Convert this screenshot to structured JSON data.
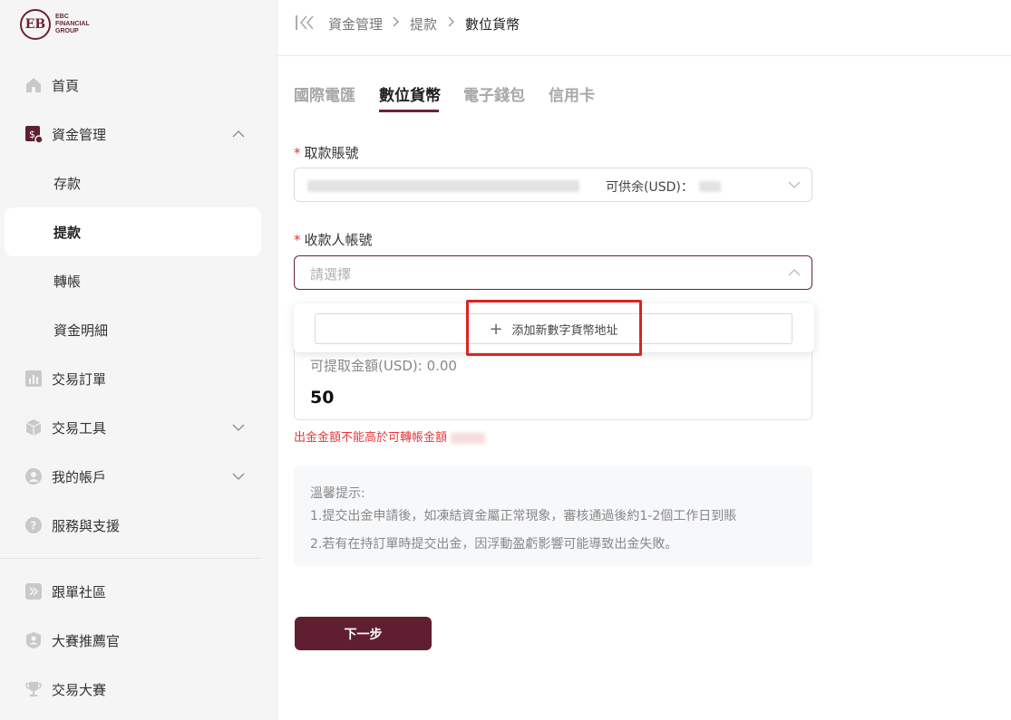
{
  "brand": {
    "logo_text": "EBC\nFINANCIAL\nGROUP",
    "accent": "#6b2434",
    "button_color": "#5f1f30"
  },
  "sidebar": {
    "home": "首頁",
    "funds": "資金管理",
    "deposit": "存款",
    "withdraw": "提款",
    "transfer": "轉帳",
    "funds_detail": "資金明細",
    "orders": "交易訂單",
    "tools": "交易工具",
    "account": "我的帳戶",
    "support": "服務與支援",
    "copy": "跟單社區",
    "referral": "大賽推薦官",
    "contest": "交易大賽"
  },
  "breadcrumb": {
    "level1": "資金管理",
    "level2": "提款",
    "current": "數位貨幣"
  },
  "tabs": [
    "國際電匯",
    "數位貨幣",
    "電子錢包",
    "信用卡"
  ],
  "form": {
    "account_label": "取款賬號",
    "account_balance_label": "可供余(USD)：",
    "payee_label": "收款人帳號",
    "payee_placeholder": "請選擇",
    "add_address": "添加新數字貨幣地址",
    "available_amount": "可提取金額(USD): 0.00",
    "amount_value": "50",
    "error": "出金金額不能高於可轉帳金額"
  },
  "tips": {
    "title": "溫馨提示:",
    "line1": "1.提交出金申請後，如凍結資金屬正常現象，審核通過後約1-2個工作日到賬",
    "line2": "2.若有在持訂單時提交出金，因浮動盈虧影響可能導致出金失敗。"
  },
  "next_button": "下一步"
}
